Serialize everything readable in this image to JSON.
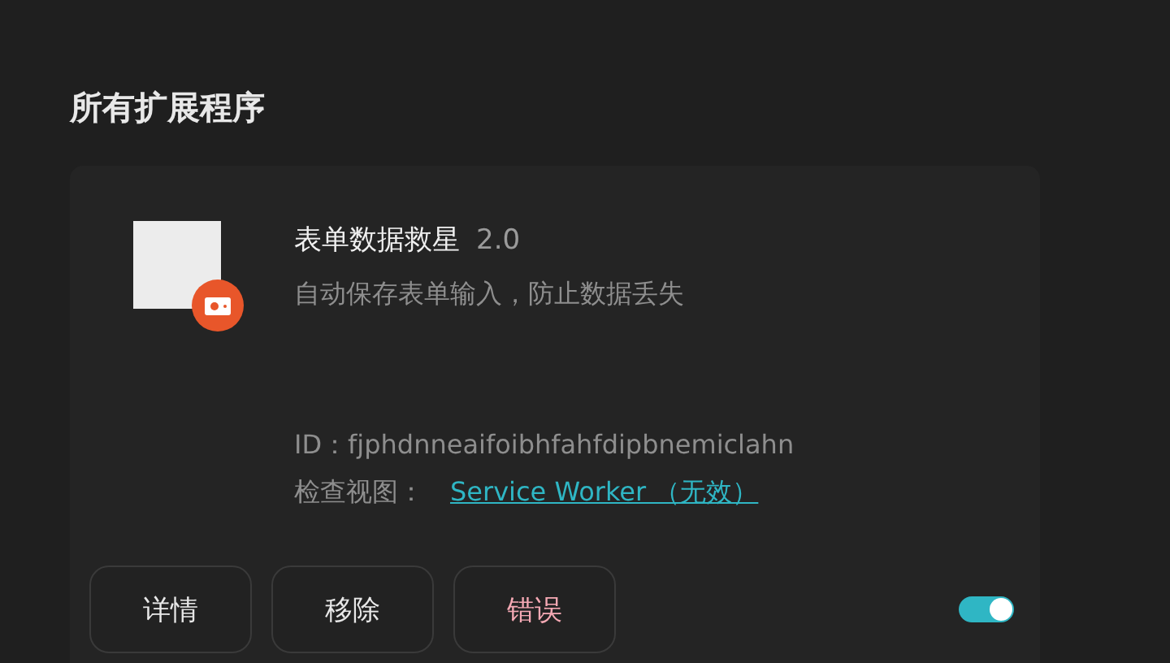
{
  "section_title": "所有扩展程序",
  "extension": {
    "name": "表单数据救星",
    "version": "2.0",
    "description": "自动保存表单输入，防止数据丢失",
    "id_label": "ID：",
    "id": "fjphdnneaifoibhfahfdipbnemiclahn",
    "inspect_label": "检查视图：",
    "inspect_link": "Service Worker （无效）",
    "enabled": true
  },
  "buttons": [
    {
      "label": "详情",
      "kind": "normal"
    },
    {
      "label": "移除",
      "kind": "normal"
    },
    {
      "label": "错误",
      "kind": "error"
    }
  ]
}
